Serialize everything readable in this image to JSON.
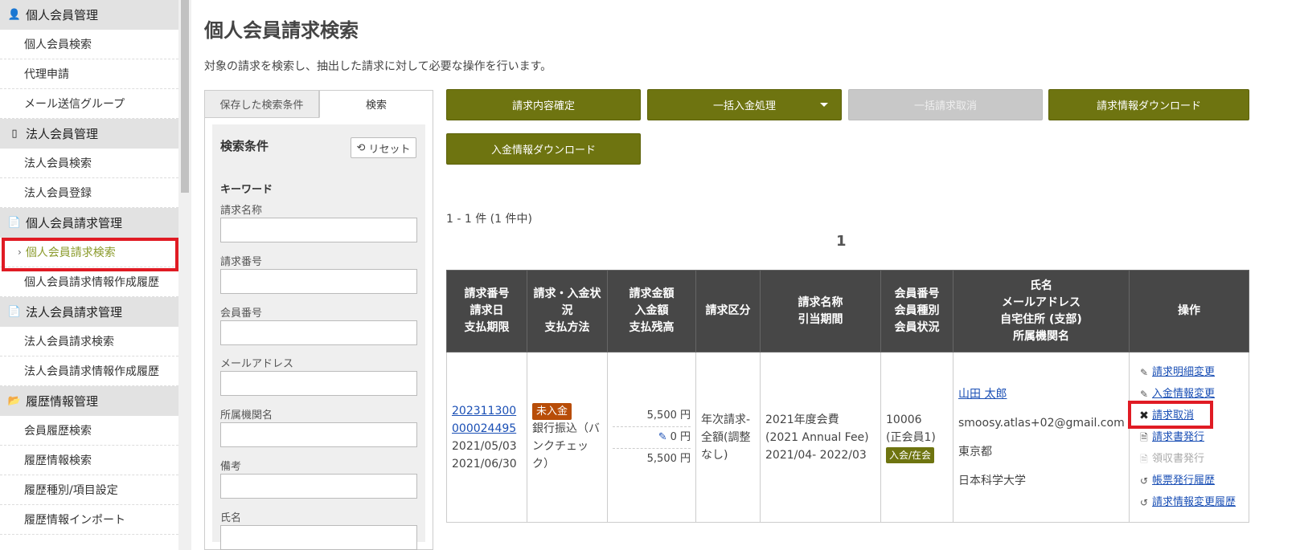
{
  "sidebar": {
    "sections": [
      {
        "title": "個人会員管理",
        "icon": "person-icon",
        "items": [
          "個人会員検索",
          "代理申請",
          "メール送信グループ"
        ]
      },
      {
        "title": "法人会員管理",
        "icon": "building-icon",
        "items": [
          "法人会員検索",
          "法人会員登録"
        ]
      },
      {
        "title": "個人会員請求管理",
        "icon": "document-icon",
        "items": [
          "個人会員請求検索",
          "個人会員請求情報作成履歴"
        ]
      },
      {
        "title": "法人会員請求管理",
        "icon": "document-icon",
        "items": [
          "法人会員請求検索",
          "法人会員請求情報作成履歴"
        ]
      },
      {
        "title": "履歴情報管理",
        "icon": "folder-icon",
        "items": [
          "会員履歴検索",
          "履歴情報検索",
          "履歴種別/項目設定",
          "履歴情報インポート"
        ]
      }
    ],
    "active_item": "個人会員請求検索"
  },
  "page": {
    "title": "個人会員請求検索",
    "description": "対象の請求を検索し、抽出した請求に対して必要な操作を行います。"
  },
  "search_panel": {
    "tabs": [
      "保存した検索条件",
      "検索"
    ],
    "condition_title": "検索条件",
    "reset_label": "リセット",
    "keyword_label": "キーワード",
    "fields": [
      "請求名称",
      "請求番号",
      "会員番号",
      "メールアドレス",
      "所属機関名",
      "備考",
      "氏名"
    ]
  },
  "actions": {
    "confirm": "請求内容確定",
    "bulk_payment": "一括入金処理",
    "bulk_cancel": "一括請求取消",
    "download_billing": "請求情報ダウンロード",
    "download_payment": "入金情報ダウンロード"
  },
  "results": {
    "count_text": "1 - 1 件 (1 件中)",
    "page": "1",
    "headers": [
      [
        "請求番号",
        "請求日",
        "支払期限"
      ],
      [
        "請求・入金状",
        "況",
        "支払方法"
      ],
      [
        "請求金額",
        "入金額",
        "支払残高"
      ],
      [
        "請求区分"
      ],
      [
        "請求名称",
        "引当期間"
      ],
      [
        "会員番号",
        "会員種別",
        "会員状況"
      ],
      [
        "氏名",
        "メールアドレス",
        "自宅住所 (支部)",
        "所属機関名"
      ],
      [
        "操作"
      ]
    ],
    "row": {
      "billing_no_1": "202311300",
      "billing_no_2": "000024495",
      "billing_date": "2021/05/03",
      "due_date": "2021/06/30",
      "status_badge": "未入金",
      "payment_method": "銀行振込（バンクチェック）",
      "amount": "5,500 円",
      "paid": "0 円",
      "balance": "5,500 円",
      "category": "年次請求-全額(調整なし)",
      "name_1": "2021年度会費",
      "name_2": "(2021 Annual Fee)",
      "period": "2021/04- 2022/03",
      "member_no": "10006",
      "member_type": "(正会員1)",
      "member_status": "入会/在会",
      "person_name": "山田 太郎",
      "email": "smoosy.atlas+02@gmail.com",
      "address": "東京都",
      "organization": "日本科学大学",
      "operations": [
        {
          "label": "請求明細変更",
          "icon": "pencil-icon",
          "enabled": true
        },
        {
          "label": "入金情報変更",
          "icon": "pencil-icon",
          "enabled": true
        },
        {
          "label": "請求取消",
          "icon": "close-icon",
          "enabled": true
        },
        {
          "label": "請求書発行",
          "icon": "file-icon",
          "enabled": true
        },
        {
          "label": "領収書発行",
          "icon": "file-icon",
          "enabled": false
        },
        {
          "label": "帳票発行履歴",
          "icon": "history-icon",
          "enabled": true
        },
        {
          "label": "請求情報変更履歴",
          "icon": "history-icon",
          "enabled": true
        }
      ]
    }
  }
}
